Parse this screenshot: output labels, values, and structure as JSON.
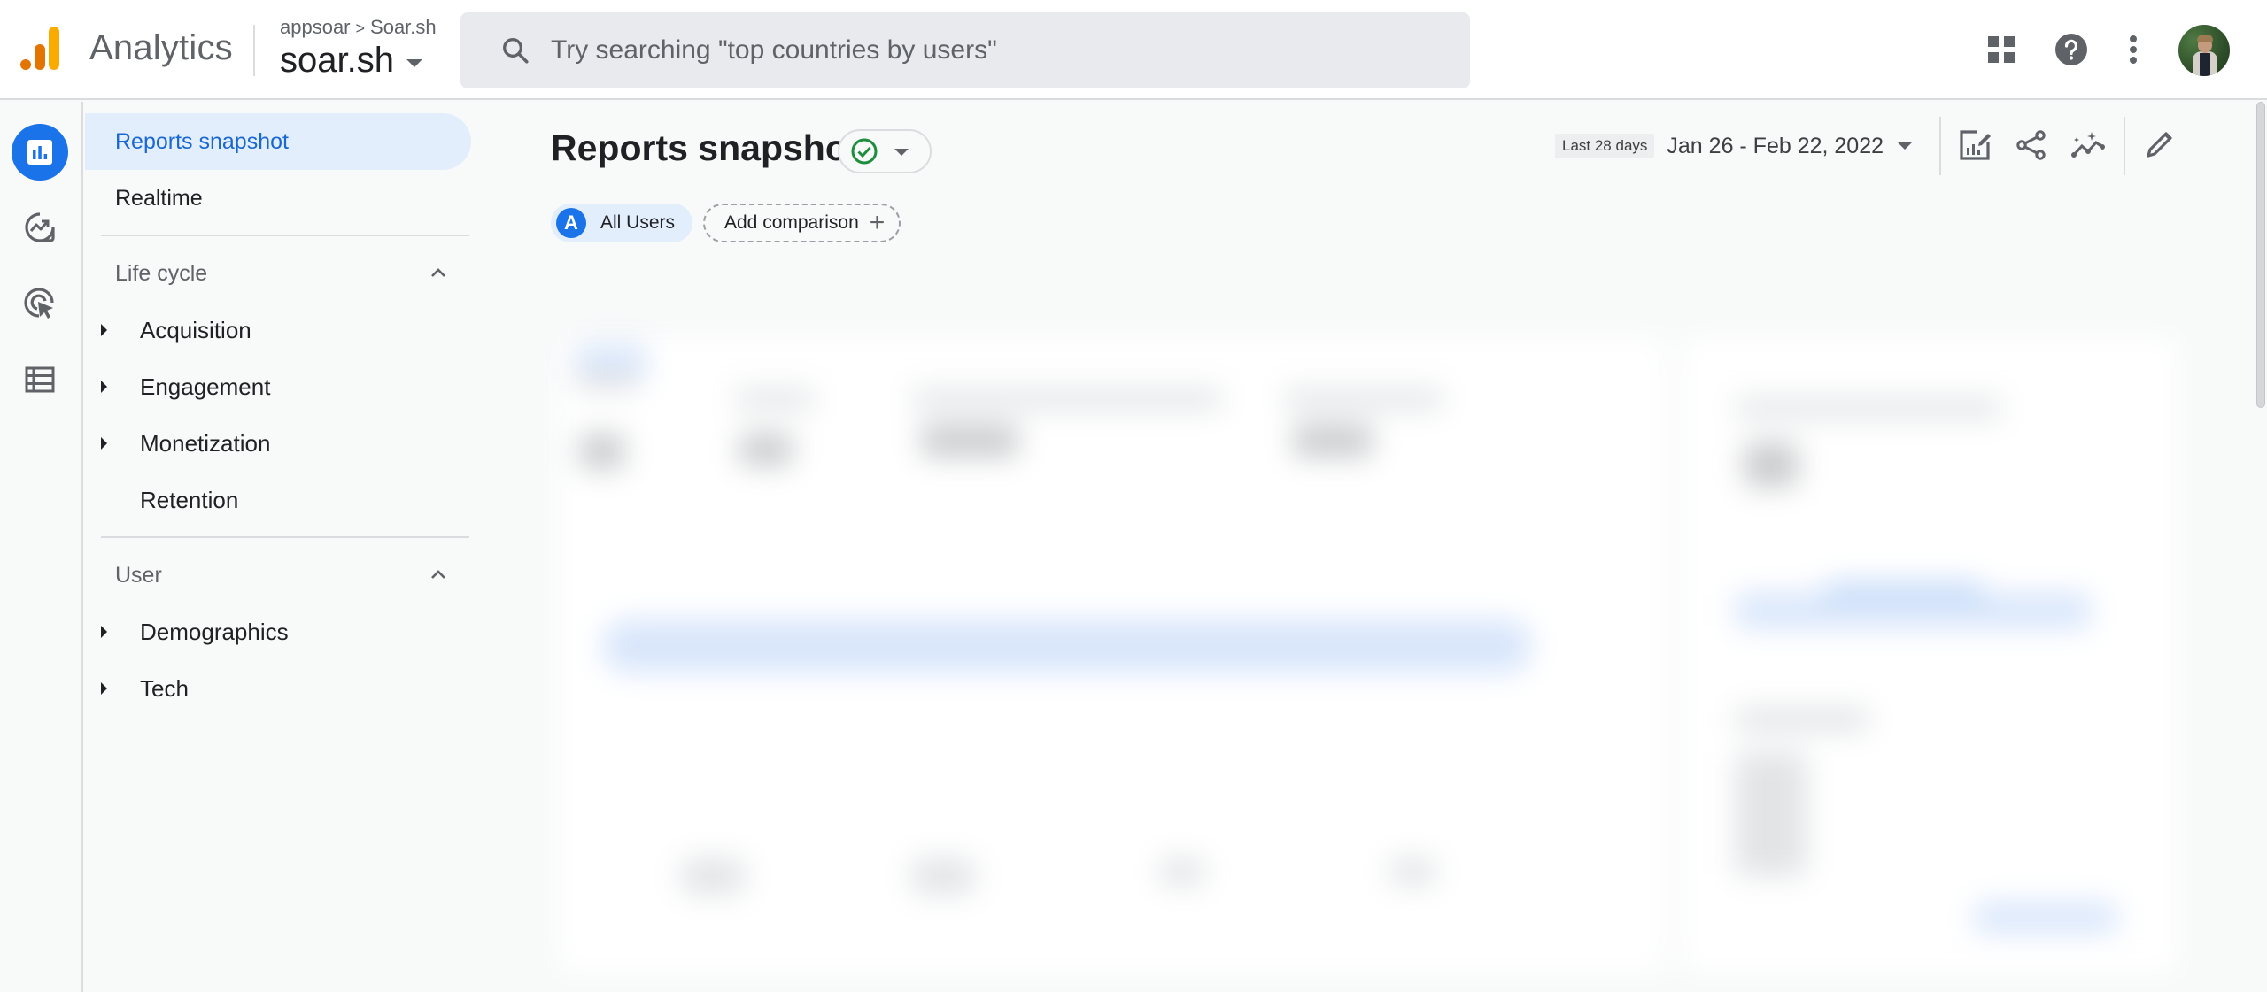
{
  "app": {
    "product_name": "Analytics",
    "breadcrumb": {
      "account": "appsoar",
      "separator": ">",
      "property_path": "Soar.sh"
    },
    "property_name": "soar.sh"
  },
  "search": {
    "placeholder": "Try searching \"top countries by users\"",
    "value": ""
  },
  "top_actions": [
    {
      "name": "apps-grid-icon",
      "label": "Apps"
    },
    {
      "name": "help-icon",
      "label": "Help"
    },
    {
      "name": "more-vert-icon",
      "label": "More"
    },
    {
      "name": "avatar",
      "label": "Account"
    }
  ],
  "rail": [
    {
      "name": "reports-icon",
      "label": "Reports",
      "active": true
    },
    {
      "name": "explore-icon",
      "label": "Explore",
      "active": false
    },
    {
      "name": "advertising-icon",
      "label": "Advertising",
      "active": false
    },
    {
      "name": "configure-icon",
      "label": "Configure",
      "active": false
    }
  ],
  "nav": {
    "top_items": [
      {
        "label": "Reports snapshot",
        "active": true
      },
      {
        "label": "Realtime",
        "active": false
      }
    ],
    "sections": [
      {
        "title": "Life cycle",
        "expanded": true,
        "items": [
          {
            "label": "Acquisition",
            "expandable": true
          },
          {
            "label": "Engagement",
            "expandable": true
          },
          {
            "label": "Monetization",
            "expandable": true
          },
          {
            "label": "Retention",
            "expandable": false
          }
        ]
      },
      {
        "title": "User",
        "expanded": true,
        "items": [
          {
            "label": "Demographics",
            "expandable": true
          },
          {
            "label": "Tech",
            "expandable": true
          }
        ]
      }
    ]
  },
  "main": {
    "title": "Reports snapshot",
    "status": "verified",
    "comparison": {
      "segment_badge": "A",
      "segment_label": "All Users",
      "add_label": "Add comparison",
      "add_icon": "+"
    },
    "date": {
      "preset": "Last 28 days",
      "range": "Jan 26 - Feb 22, 2022"
    },
    "toolbar": [
      {
        "name": "customize-report-icon",
        "label": "Customize report"
      },
      {
        "name": "share-icon",
        "label": "Share this report"
      },
      {
        "name": "insights-icon",
        "label": "Insights"
      },
      {
        "name": "edit-icon",
        "label": "Edit"
      }
    ],
    "content_state": "loading (blurred)"
  },
  "colors": {
    "accent": "#1a73e8",
    "active_nav_bg": "#e3eefc",
    "active_nav_text": "#1967d2",
    "success": "#1e8e3e",
    "logo_orange_dark": "#e37400",
    "logo_orange_light": "#f9ab00"
  }
}
